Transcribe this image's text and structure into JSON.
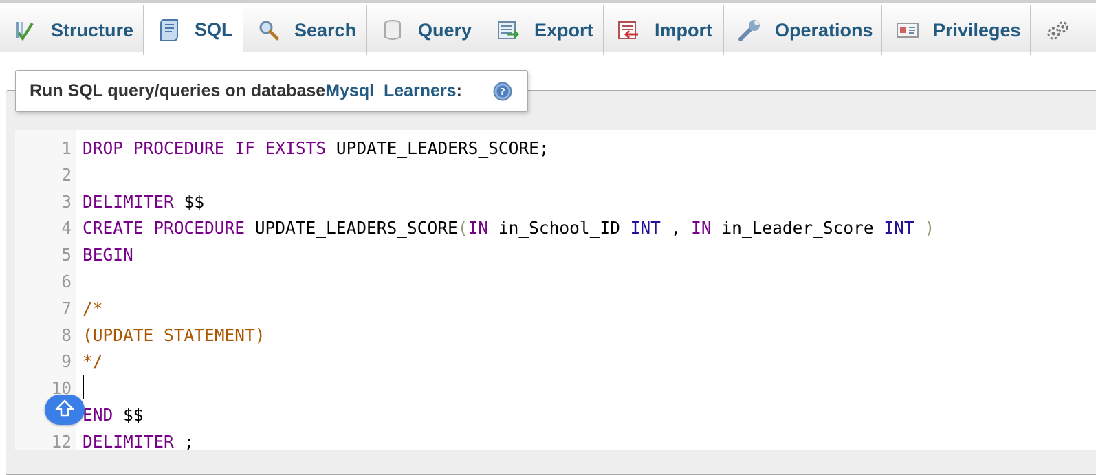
{
  "tabs": [
    {
      "label": "Structure",
      "icon": "structure-icon",
      "active": false
    },
    {
      "label": "SQL",
      "icon": "sql-icon",
      "active": true
    },
    {
      "label": "Search",
      "icon": "search-icon",
      "active": false
    },
    {
      "label": "Query",
      "icon": "query-icon",
      "active": false
    },
    {
      "label": "Export",
      "icon": "export-icon",
      "active": false
    },
    {
      "label": "Import",
      "icon": "import-icon",
      "active": false
    },
    {
      "label": "Operations",
      "icon": "operations-icon",
      "active": false
    },
    {
      "label": "Privileges",
      "icon": "privileges-icon",
      "active": false
    },
    {
      "label": "",
      "icon": "routines-icon",
      "active": false
    }
  ],
  "panel": {
    "title_prefix": "Run SQL query/queries on database ",
    "database": "Mysql_Learners",
    "title_suffix": ":"
  },
  "editor": {
    "lines": [
      {
        "n": "1",
        "tokens": [
          [
            "kw",
            "DROP"
          ],
          [
            "",
            " "
          ],
          [
            "kw",
            "PROCEDURE"
          ],
          [
            "",
            " "
          ],
          [
            "kw",
            "IF"
          ],
          [
            "",
            " "
          ],
          [
            "kw",
            "EXISTS"
          ],
          [
            "",
            " UPDATE_LEADERS_SCORE;"
          ]
        ]
      },
      {
        "n": "2",
        "tokens": []
      },
      {
        "n": "3",
        "tokens": [
          [
            "kw",
            "DELIMITER"
          ],
          [
            "",
            " $$"
          ]
        ]
      },
      {
        "n": "4",
        "tokens": [
          [
            "kw",
            "CREATE"
          ],
          [
            "",
            " "
          ],
          [
            "kw",
            "PROCEDURE"
          ],
          [
            "",
            " UPDATE_LEADERS_SCORE"
          ],
          [
            "par",
            "("
          ],
          [
            "kw",
            "IN"
          ],
          [
            "",
            " in_School_ID "
          ],
          [
            "typ",
            "INT"
          ],
          [
            "",
            " , "
          ],
          [
            "kw",
            "IN"
          ],
          [
            "",
            " in_Leader_Score "
          ],
          [
            "typ",
            "INT"
          ],
          [
            "",
            " "
          ],
          [
            "par",
            ")"
          ]
        ]
      },
      {
        "n": "5",
        "tokens": [
          [
            "kw",
            "BEGIN"
          ]
        ]
      },
      {
        "n": "6",
        "tokens": []
      },
      {
        "n": "7",
        "tokens": [
          [
            "cmt",
            "/*"
          ]
        ]
      },
      {
        "n": "8",
        "tokens": [
          [
            "cmt",
            "(UPDATE STATEMENT)"
          ]
        ]
      },
      {
        "n": "9",
        "tokens": [
          [
            "cmt",
            "*/"
          ]
        ]
      },
      {
        "n": "10",
        "tokens": []
      },
      {
        "n": "11",
        "tokens": [
          [
            "kw",
            "END"
          ],
          [
            "",
            " $$"
          ]
        ]
      },
      {
        "n": "12",
        "tokens": [
          [
            "kw",
            "DELIMITER"
          ],
          [
            "",
            " ;"
          ]
        ]
      }
    ]
  },
  "colors": {
    "link": "#235a81",
    "keyword": "#770088",
    "type": "#221199",
    "comment": "#aa5500",
    "bracket": "#999977",
    "scroll_button": "#3a7fe8"
  }
}
